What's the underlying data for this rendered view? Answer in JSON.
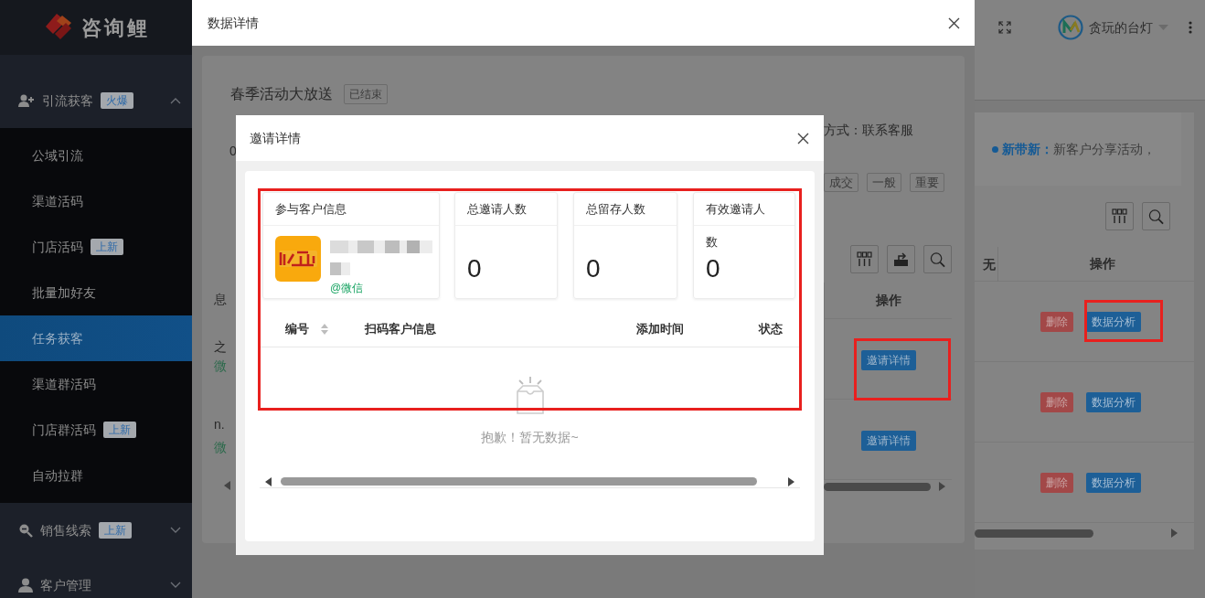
{
  "sidebar": {
    "brand": "咨询鲤",
    "groups": [
      {
        "label": "引流获客",
        "badge": "火爆",
        "expanded": true,
        "items": [
          {
            "label": "公域引流",
            "selected": false
          },
          {
            "label": "渠道活码",
            "selected": false
          },
          {
            "label": "门店活码",
            "badge": "上新",
            "selected": false
          },
          {
            "label": "批量加好友",
            "selected": false
          },
          {
            "label": "任务获客",
            "selected": true
          },
          {
            "label": "渠道群活码",
            "selected": false
          },
          {
            "label": "门店群活码",
            "badge": "上新",
            "selected": false
          },
          {
            "label": "自动拉群",
            "selected": false
          }
        ]
      },
      {
        "label": "销售线索",
        "badge": "上新",
        "expanded": false
      },
      {
        "label": "客户管理",
        "expanded": false
      }
    ]
  },
  "header": {
    "user": "贪玩的台灯"
  },
  "page": {
    "notice_label": "新带新：",
    "notice_text": "新客户分享活动，",
    "columns": [
      "无",
      "操作"
    ],
    "rows": [
      {
        "actions": [
          "删除",
          "数据分析"
        ],
        "highlighted": true
      },
      {
        "actions": [
          "删除",
          "数据分析"
        ],
        "highlighted": false
      },
      {
        "actions": [
          "删除",
          "数据分析"
        ],
        "highlighted": false
      }
    ]
  },
  "data_dialog": {
    "title": "数据详情",
    "activity": {
      "name": "春季活动大放送",
      "status": "已结束"
    },
    "summary_fragment": "0",
    "contact": "方式：联系客服",
    "tags": [
      "成交",
      "一般",
      "重要"
    ],
    "table": {
      "left_header": "息",
      "column": "操作",
      "rows": [
        {
          "fragments": [
            "之",
            "微"
          ],
          "action": "邀请详情",
          "highlighted": true
        },
        {
          "fragments": [
            "n.",
            "微"
          ],
          "action": "邀请详情",
          "highlighted": false
        }
      ]
    }
  },
  "invite_dialog": {
    "title": "邀请详情",
    "highlighted": true,
    "participant": {
      "label": "参与客户信息",
      "source": "@微信"
    },
    "stats": [
      {
        "label": "总邀请人数",
        "value": "0"
      },
      {
        "label": "总留存人数",
        "value": "0"
      },
      {
        "label": "有效邀请人数",
        "value": "0"
      }
    ],
    "columns": [
      {
        "label": "编号",
        "sortable": true
      },
      {
        "label": "扫码客户信息",
        "sortable": false
      },
      {
        "label": "添加时间",
        "sortable": false
      },
      {
        "label": "状态",
        "sortable": false
      }
    ],
    "empty_text": "抱歉！暂无数据~"
  }
}
